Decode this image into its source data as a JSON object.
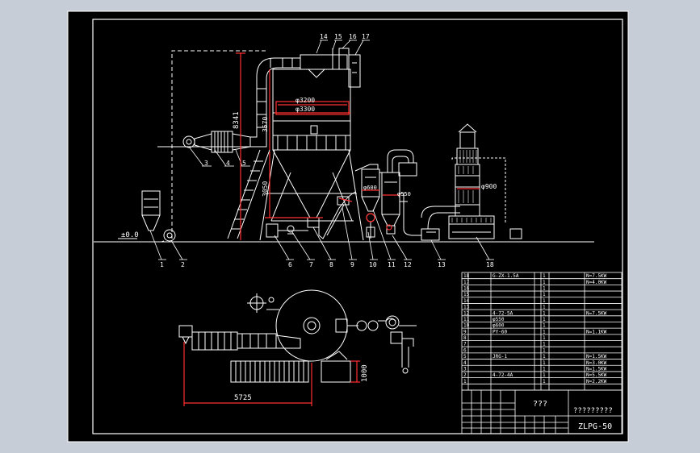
{
  "frame": {
    "bg": "#c7cdd6",
    "paper": "#000000",
    "line": "#ffffff",
    "dim": "#ff3030",
    "aux": "#d8d8d8"
  },
  "elevation": {
    "ground_mark": "±0.0",
    "dim_height_total": "8341",
    "dim_height_top": "3570",
    "dim_height_cone": "3050",
    "dia_inner": "φ3200",
    "dia_outer": "φ3300",
    "dia_cyclone_1": "φ600",
    "dia_cyclone_2": "φ550",
    "dia_scrubber": "φ900",
    "leaders": [
      "1",
      "2",
      "3",
      "4",
      "5",
      "6",
      "7",
      "8",
      "9",
      "10",
      "11",
      "12",
      "13",
      "14",
      "15",
      "16",
      "17",
      "18"
    ]
  },
  "plan": {
    "dim_length": "5725",
    "dim_width": "1000"
  },
  "title_block": {
    "drawing_title": "???",
    "company": "?????????",
    "drawing_no": "ZLPG-50",
    "parts": [
      {
        "no": "18",
        "name": "G-ZX-1.5A",
        "qty": "1",
        "note": "N=7.5KW"
      },
      {
        "no": "17",
        "name": "",
        "qty": "1",
        "note": "N=4.0KW"
      },
      {
        "no": "16",
        "name": "",
        "qty": "1",
        "note": ""
      },
      {
        "no": "15",
        "name": "",
        "qty": "1",
        "note": ""
      },
      {
        "no": "14",
        "name": "",
        "qty": "1",
        "note": ""
      },
      {
        "no": "13",
        "name": "",
        "qty": "1",
        "note": ""
      },
      {
        "no": "12",
        "name": "4-72-5A",
        "qty": "1",
        "note": "N=7.5KW"
      },
      {
        "no": "11",
        "name": "φ550",
        "qty": "1",
        "note": ""
      },
      {
        "no": "10",
        "name": "φ600",
        "qty": "1",
        "note": ""
      },
      {
        "no": "9",
        "name": "PY-60",
        "qty": "1",
        "note": "N=1.1KW"
      },
      {
        "no": "8",
        "name": "",
        "qty": "1",
        "note": ""
      },
      {
        "no": "7",
        "name": "",
        "qty": "1",
        "note": ""
      },
      {
        "no": "6",
        "name": "",
        "qty": "1",
        "note": ""
      },
      {
        "no": "5",
        "name": "JRG-1",
        "qty": "1",
        "note": "N=1.5KW"
      },
      {
        "no": "4",
        "name": "",
        "qty": "1",
        "note": "N=3.0KW"
      },
      {
        "no": "3",
        "name": "",
        "qty": "1",
        "note": "N=1.5KW"
      },
      {
        "no": "2",
        "name": "4-72-4A",
        "qty": "1",
        "note": "N=5.5KW"
      },
      {
        "no": "1",
        "name": "",
        "qty": "1",
        "note": "N=2.2KW"
      },
      {
        "no": "",
        "name": "",
        "qty": "",
        "note": ""
      }
    ]
  }
}
